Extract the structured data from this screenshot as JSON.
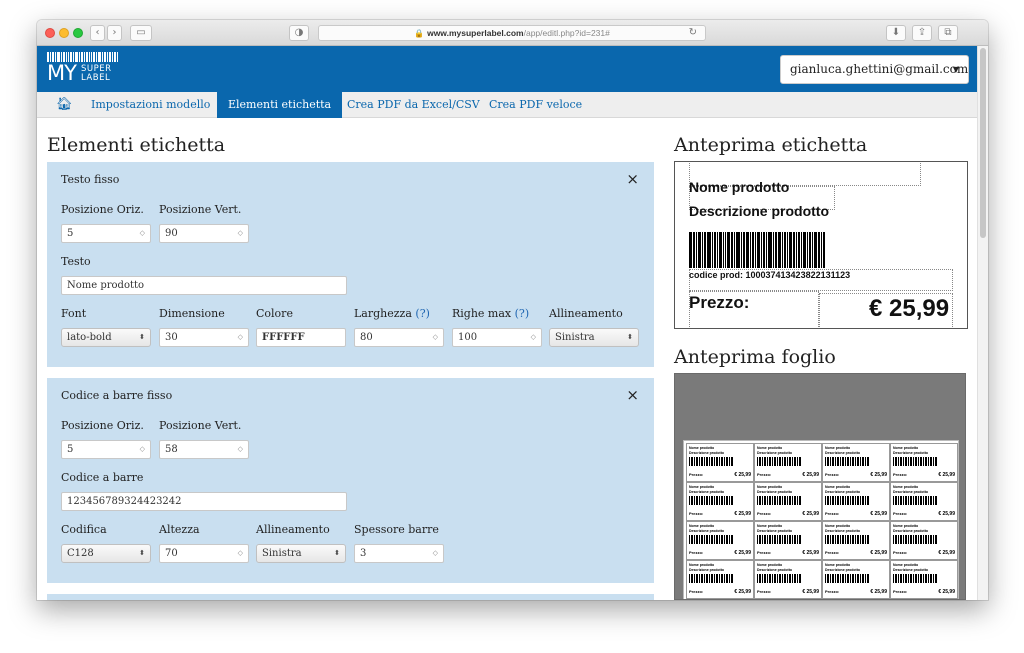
{
  "browser": {
    "url_domain": "www.mysuperlabel.com",
    "url_path": "/app/editl.php?id=231#",
    "back_icon": "chevron-left",
    "forward_icon": "chevron-right"
  },
  "header": {
    "logo": {
      "my": "MY",
      "super": "SUPER",
      "label": "LABEL"
    },
    "user_email": "gianluca.ghettini@gmail.com",
    "brand_color": "#0a67ad"
  },
  "nav": {
    "items": [
      {
        "label": "Impostazioni modello",
        "active": false
      },
      {
        "label": "Elementi etichetta",
        "active": true
      },
      {
        "label": "Crea PDF da Excel/CSV",
        "active": false
      },
      {
        "label": "Crea PDF veloce",
        "active": false
      }
    ]
  },
  "main": {
    "title": "Elementi etichetta",
    "text_panel": {
      "title": "Testo fisso",
      "close": "×",
      "pos_h_label": "Posizione Oriz.",
      "pos_h_value": "5",
      "pos_v_label": "Posizione Vert.",
      "pos_v_value": "90",
      "text_label": "Testo",
      "text_value": "Nome prodotto",
      "font_label": "Font",
      "font_value": "lato-bold",
      "size_label": "Dimensione",
      "size_value": "30",
      "color_label": "Colore",
      "color_value": "FFFFFF",
      "width_label": "Larghezza",
      "width_help": "(?)",
      "width_value": "80",
      "maxrows_label": "Righe max",
      "maxrows_help": "(?)",
      "maxrows_value": "100",
      "align_label": "Allineamento",
      "align_value": "Sinistra"
    },
    "barcode_panel": {
      "title": "Codice a barre fisso",
      "close": "×",
      "pos_h_label": "Posizione Oriz.",
      "pos_h_value": "5",
      "pos_v_label": "Posizione Vert.",
      "pos_v_value": "58",
      "code_label": "Codice a barre",
      "code_value": "123456789324423242",
      "encoding_label": "Codifica",
      "encoding_value": "C128",
      "height_label": "Altezza",
      "height_value": "70",
      "align_label": "Allineamento",
      "align_value": "Sinistra",
      "thickness_label": "Spessore barre",
      "thickness_value": "3"
    }
  },
  "side": {
    "label_preview_title": "Anteprima etichetta",
    "label": {
      "name": "Nome prodotto",
      "description": "Descrizione prodotto",
      "code": "codice prod: 100037413423822131123",
      "price_label": "Prezzo:",
      "price_value": "€ 25,99"
    },
    "sheet_preview_title": "Anteprima foglio",
    "sheet_cell": {
      "name": "Nome prodotto",
      "description": "Descrizione prodotto",
      "price_label": "Prezzo:",
      "price_value": "€ 25,99"
    }
  }
}
